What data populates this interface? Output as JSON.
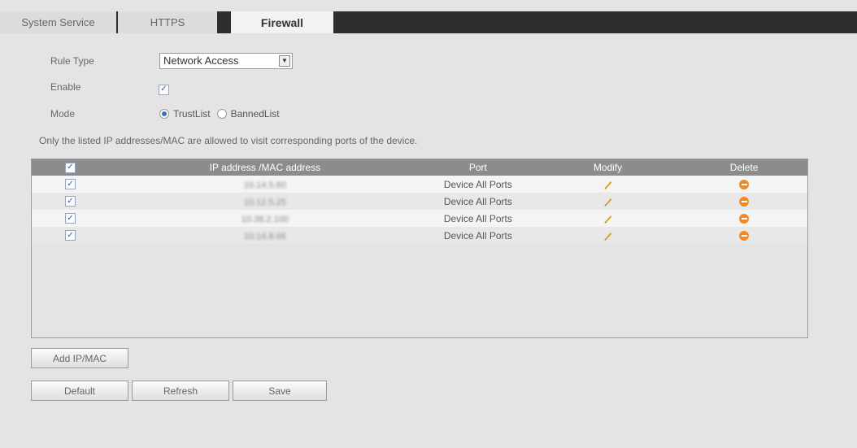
{
  "tabs": [
    {
      "label": "System Service",
      "active": false
    },
    {
      "label": "HTTPS",
      "active": false
    },
    {
      "label": "Firewall",
      "active": true
    }
  ],
  "form": {
    "rule_type_label": "Rule Type",
    "rule_type_value": "Network Access",
    "enable_label": "Enable",
    "enable_checked": true,
    "mode_label": "Mode",
    "mode_options": [
      "TrustList",
      "BannedList"
    ],
    "mode_selected": "TrustList"
  },
  "info_text": "Only the listed IP addresses/MAC are allowed to visit corresponding ports of the device.",
  "table": {
    "headers": [
      "IP address /MAC address",
      "Port",
      "Modify",
      "Delete"
    ],
    "rows": [
      {
        "ip": "10.14.5.60",
        "port": "Device All Ports"
      },
      {
        "ip": "10.12.5.25",
        "port": "Device All Ports"
      },
      {
        "ip": "10.38.2.100",
        "port": "Device All Ports"
      },
      {
        "ip": "10.14.8.66",
        "port": "Device All Ports"
      }
    ]
  },
  "buttons": {
    "add": "Add IP/MAC",
    "default": "Default",
    "refresh": "Refresh",
    "save": "Save"
  },
  "colors": {
    "tabbar": "#2e2e2e",
    "table_header": "#8c8c8c",
    "delete_icon": "#f08a24",
    "modify_icon": "#e0a020"
  },
  "icons": {
    "modify": "pencil-icon",
    "delete": "minus-circle-icon",
    "select": "chevron-down-icon"
  }
}
